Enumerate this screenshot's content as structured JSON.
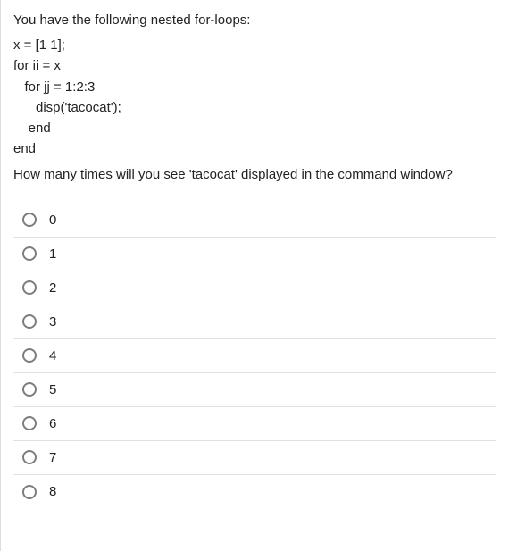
{
  "question": {
    "intro": "You have the following nested for-loops:",
    "code": "x = [1 1];\nfor ii = x\n   for jj = 1:2:3\n      disp('tacocat');\n    end\nend",
    "after": "How many times will you see 'tacocat' displayed in the command window?"
  },
  "options": [
    {
      "label": "0"
    },
    {
      "label": "1"
    },
    {
      "label": "2"
    },
    {
      "label": "3"
    },
    {
      "label": "4"
    },
    {
      "label": "5"
    },
    {
      "label": "6"
    },
    {
      "label": "7"
    },
    {
      "label": "8"
    }
  ]
}
